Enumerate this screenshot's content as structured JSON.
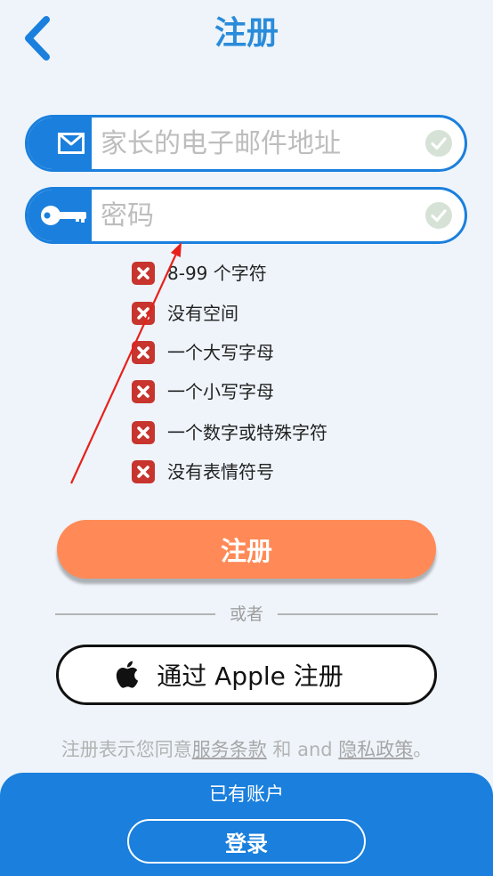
{
  "colors": {
    "primary_blue": "#1A7FDD",
    "title_blue": "#2A8BDA",
    "register_orange": "#FF8A57",
    "error_red": "#C7352E",
    "background": "#EEF4FA",
    "valid_indicator": "#D6E2D6"
  },
  "header": {
    "title": "注册",
    "back_icon": "chevron-left-icon"
  },
  "form": {
    "email": {
      "placeholder": "家长的电子邮件地址",
      "value": "",
      "icon": "envelope-icon",
      "status_icon": "check-circle-icon"
    },
    "password": {
      "placeholder": "密码",
      "value": "",
      "icon": "key-icon",
      "status_icon": "check-circle-icon"
    }
  },
  "password_requirements": [
    {
      "label": "8-99 个字符",
      "met": false,
      "icon": "x-mark-icon"
    },
    {
      "label": "没有空间",
      "met": false,
      "icon": "x-mark-icon"
    },
    {
      "label": "一个大写字母",
      "met": false,
      "icon": "x-mark-icon"
    },
    {
      "label": "一个小写字母",
      "met": false,
      "icon": "x-mark-icon"
    },
    {
      "label": "一个数字或特殊字符",
      "met": false,
      "icon": "x-mark-icon"
    },
    {
      "label": "没有表情符号",
      "met": false,
      "icon": "x-mark-icon"
    }
  ],
  "register_button": {
    "label": "注册"
  },
  "divider": {
    "label": "或者"
  },
  "apple_signup": {
    "label": "通过 Apple 注册",
    "icon": "apple-icon"
  },
  "terms": {
    "prefix": "注册表示您同意",
    "terms_link": "服务条款",
    "middle": " 和 and ",
    "privacy_link": "隐私政策",
    "suffix": "。"
  },
  "footer": {
    "prompt": "已有账户",
    "login_button": "登录"
  }
}
